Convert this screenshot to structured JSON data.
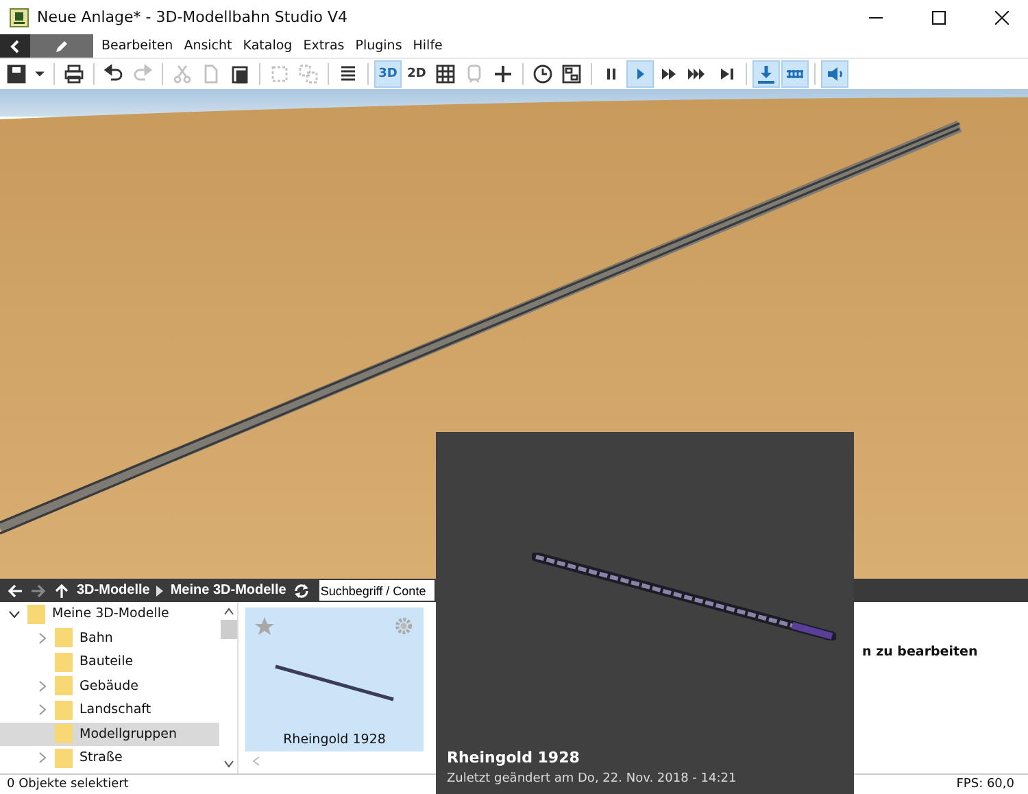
{
  "window": {
    "title": "Neue Anlage* - 3D-Modellbahn Studio V4"
  },
  "menu": [
    "Bearbeiten",
    "Ansicht",
    "Katalog",
    "Extras",
    "Plugins",
    "Hilfe"
  ],
  "toolbar_groups": [
    [
      {
        "selected": false,
        "disabled": false
      },
      {
        "selected": false,
        "disabled": false
      }
    ],
    [
      {
        "selected": false,
        "disabled": false
      }
    ],
    [
      {
        "selected": false,
        "disabled": false
      },
      {
        "selected": false,
        "disabled": true
      }
    ],
    [
      {
        "selected": false,
        "disabled": true
      },
      {
        "selected": false,
        "disabled": true
      },
      {
        "selected": false,
        "disabled": false
      }
    ],
    [
      {
        "selected": false,
        "disabled": true
      },
      {
        "selected": false,
        "disabled": true
      }
    ],
    [
      {
        "selected": false,
        "disabled": false
      }
    ],
    [
      {
        "label": "3D",
        "selected": true,
        "disabled": false
      },
      {
        "label": "2D",
        "selected": false,
        "disabled": false
      },
      {
        "selected": false,
        "disabled": false
      },
      {
        "selected": false,
        "disabled": true
      },
      {
        "selected": false,
        "disabled": false
      }
    ],
    [
      {
        "selected": false,
        "disabled": false
      },
      {
        "selected": false,
        "disabled": false
      }
    ],
    [
      {
        "selected": false,
        "disabled": false
      },
      {
        "selected": true,
        "disabled": false
      },
      {
        "selected": false,
        "disabled": false
      },
      {
        "selected": false,
        "disabled": false
      },
      {
        "selected": false,
        "disabled": false
      }
    ],
    [
      {
        "selected": true,
        "disabled": false
      },
      {
        "selected": true,
        "disabled": false
      }
    ],
    [
      {
        "selected": true,
        "disabled": false
      }
    ]
  ],
  "breadcrumb": [
    "3D-Modelle",
    "Meine 3D-Modelle"
  ],
  "search": {
    "value": "Suchbegriff / Conte"
  },
  "tree": [
    {
      "label": "Meine 3D-Modelle",
      "expandable": true,
      "expanded": true,
      "selected": false,
      "children": [
        {
          "label": "Bahn",
          "expandable": true,
          "expanded": false,
          "selected": false
        },
        {
          "label": "Bauteile",
          "expandable": false,
          "selected": false
        },
        {
          "label": "Gebäude",
          "expandable": true,
          "expanded": false,
          "selected": false
        },
        {
          "label": "Landschaft",
          "expandable": true,
          "expanded": false,
          "selected": false
        },
        {
          "label": "Modellgruppen",
          "expandable": false,
          "selected": true
        },
        {
          "label": "Straße",
          "expandable": true,
          "expanded": false,
          "selected": false
        }
      ]
    }
  ],
  "model_card": {
    "name": "Rheingold 1928",
    "favorite": false
  },
  "details_hint": "n zu bearbeiten",
  "tooltip": {
    "title": "Rheingold 1928",
    "subtitle": "Zuletzt geändert am Do, 22. Nov. 2018 - 14:21"
  },
  "status_bar": {
    "selection": "0 Objekte selektiert",
    "fps": "FPS: 60,0"
  }
}
